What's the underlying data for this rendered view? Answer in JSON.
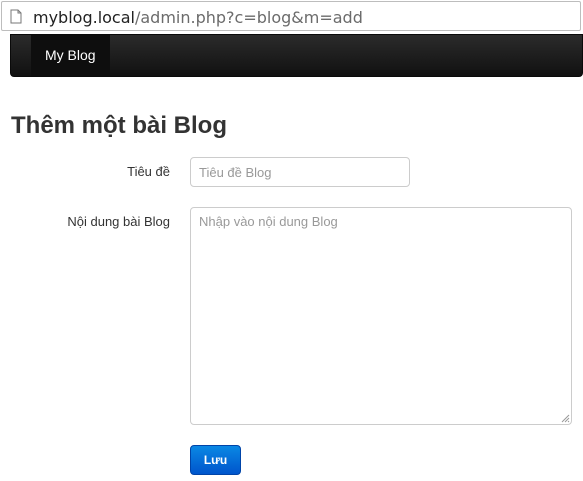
{
  "browser": {
    "url_host": "myblog.local",
    "url_path": "/admin.php?c=blog&m=add"
  },
  "navbar": {
    "brand": "My Blog"
  },
  "form": {
    "page_title": "Thêm một bài Blog",
    "title_label": "Tiêu đề",
    "title_placeholder": "Tiêu đề Blog",
    "content_label": "Nội dung bài Blog",
    "content_placeholder": "Nhập vào nội dung Blog",
    "save_label": "Lưu"
  }
}
